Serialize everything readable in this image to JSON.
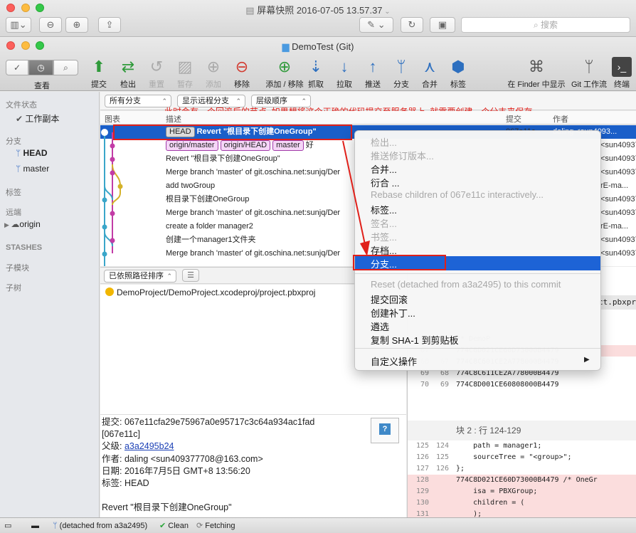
{
  "outer_window": {
    "title": "屏幕快照 2016-07-05 13.57.37",
    "search_placeholder": "搜索"
  },
  "app_window": {
    "title": "DemoTest (Git)",
    "view_label": "查看",
    "toolbar": [
      {
        "label": "提交",
        "icon": "commit-icon",
        "enabled": true
      },
      {
        "label": "检出",
        "icon": "checkout-icon",
        "enabled": true
      },
      {
        "label": "重置",
        "icon": "reset-icon",
        "enabled": false
      },
      {
        "label": "暂存",
        "icon": "stage-icon",
        "enabled": false
      },
      {
        "label": "添加",
        "icon": "add-icon",
        "enabled": false
      },
      {
        "label": "移除",
        "icon": "remove-icon",
        "enabled": true
      },
      {
        "label": "添加 / 移除",
        "icon": "add-remove-icon",
        "enabled": true
      },
      {
        "label": "抓取",
        "icon": "fetch-icon",
        "enabled": true
      },
      {
        "label": "拉取",
        "icon": "pull-icon",
        "enabled": true
      },
      {
        "label": "推送",
        "icon": "push-icon",
        "enabled": true
      },
      {
        "label": "分支",
        "icon": "branch-icon",
        "enabled": true
      },
      {
        "label": "合并",
        "icon": "merge-icon",
        "enabled": true
      },
      {
        "label": "标签",
        "icon": "tag-icon",
        "enabled": true
      }
    ],
    "toolbar_right": [
      {
        "label": "在 Finder 中显示",
        "icon": "finder-icon"
      },
      {
        "label": "Git 工作流",
        "icon": "git-flow-icon"
      },
      {
        "label": "终端",
        "icon": "terminal-icon"
      }
    ]
  },
  "sidebar": {
    "file_status_header": "文件状态",
    "working_copy": "工作副本",
    "branches_header": "分支",
    "branches": [
      "HEAD",
      "master"
    ],
    "tags_header": "标签",
    "remotes_header": "远端",
    "remotes": [
      "origin"
    ],
    "stashes_header": "STASHES",
    "submodules_header": "子模块",
    "subtrees_header": "子树"
  },
  "filters": {
    "branches": "所有分支",
    "remote_branches": "显示远程分支",
    "order": "层级顺序"
  },
  "columns": {
    "graph": "图表",
    "description": "描述",
    "commit": "提交",
    "author": "作者"
  },
  "annotation": "此时会有一个回滚后的节点, 如果想将这个正确的代码提交至服务器上, 就需要创建一个分支来保存",
  "commits": [
    {
      "tags": [
        "HEAD"
      ],
      "desc": "Revert \"根目录下创建OneGroup\"",
      "commit": "067e11c",
      "author": "daling <sun4093..."
    },
    {
      "tags": [
        "origin/master",
        "origin/HEAD",
        "master"
      ],
      "desc": "好",
      "commit": "",
      "author": "<sun40937..."
    },
    {
      "tags": [],
      "desc": "Revert \"根目录下创建OneGroup\"",
      "commit": "",
      "author": "<sun40937..."
    },
    {
      "tags": [],
      "desc": "Merge branch 'master' of git.oschina.net:sunjq/Der",
      "commit": "",
      "author": "<sun40937..."
    },
    {
      "tags": [],
      "desc": "add twoGroup",
      "commit": "",
      "author": "rE-ma..."
    },
    {
      "tags": [],
      "desc": "根目录下创建OneGroup",
      "commit": "",
      "author": "<sun40937..."
    },
    {
      "tags": [],
      "desc": "Merge branch 'master' of git.oschina.net:sunjq/Der",
      "commit": "",
      "author": "<sun40937..."
    },
    {
      "tags": [],
      "desc": "create a folder manager2",
      "commit": "",
      "author": "rE-ma..."
    },
    {
      "tags": [],
      "desc": "创建一个manager1文件夹",
      "commit": "",
      "author": "<sun40937..."
    },
    {
      "tags": [],
      "desc": "Merge branch 'master' of git.oschina.net:sunjq/Der",
      "commit": "",
      "author": "<sun40937..."
    }
  ],
  "file_list": {
    "sort": "已依照路径排序",
    "files": [
      "DemoProject/DemoProject.xcodeproj/project.pbxproj"
    ]
  },
  "details": {
    "commit_label": "提交:",
    "commit_value": "067e11cfa29e75967a0e95717c3c64a934ac1fad",
    "commit_short": "[067e11c]",
    "parent_label": "父级:",
    "parent_value": "a3a2495b24",
    "author_label": "作者:",
    "author_value": "daling <sun409377708@163.com>",
    "date_label": "日期:",
    "date_value": "2016年7月5日 GMT+8 13:56:20",
    "tags_label": "标签:",
    "tags_value": "HEAD",
    "message": "Revert \"根目录下创建OneGroup\""
  },
  "diff": {
    "file_header": "ct.pbxpro",
    "hunk_header": "块 2 : 行 124-129",
    "top_lines": [
      {
        "n1": "",
        "n2": "",
        "text": "/* DemoP",
        "type": "ctx"
      },
      {
        "n1": "67",
        "n2": "",
        "text": "774C8D021CE60D73000B4479",
        "type": "del"
      },
      {
        "n1": "68",
        "n2": "67",
        "text": "774C8C601CE2A778000B4479",
        "type": "ctx"
      },
      {
        "n1": "69",
        "n2": "68",
        "text": "774C8C611CE2A778000B4479",
        "type": "ctx"
      },
      {
        "n1": "70",
        "n2": "69",
        "text": "774C8D001CE60808000B4479",
        "type": "ctx"
      }
    ],
    "hunk_lines": [
      {
        "n1": "125",
        "n2": "124",
        "text": "    path = manager1;",
        "type": "ctx"
      },
      {
        "n1": "126",
        "n2": "125",
        "text": "    sourceTree = \"<group>\";",
        "type": "ctx"
      },
      {
        "n1": "127",
        "n2": "126",
        "text": "};",
        "type": "ctx"
      },
      {
        "n1": "128",
        "n2": "",
        "text": "774C8D021CE60D73000B4479 /* OneGr",
        "type": "del"
      },
      {
        "n1": "129",
        "n2": "",
        "text": "    isa = PBXGroup;",
        "type": "del"
      },
      {
        "n1": "130",
        "n2": "",
        "text": "    children = (",
        "type": "del"
      },
      {
        "n1": "131",
        "n2": "",
        "text": "    );",
        "type": "del"
      }
    ]
  },
  "context_menu": {
    "items": [
      {
        "label": "检出...",
        "enabled": false
      },
      {
        "label": "推送修订版本...",
        "enabled": false
      },
      {
        "label": "合并...",
        "enabled": true
      },
      {
        "label": "衍合 ...",
        "enabled": true
      },
      {
        "label": "Rebase children of 067e11c interactively...",
        "enabled": false
      },
      {
        "label": "标签...",
        "enabled": true
      },
      {
        "label": "签名...",
        "enabled": false
      },
      {
        "label": "书签...",
        "enabled": false
      },
      {
        "label": "存档...",
        "enabled": true
      },
      {
        "label": "分支...",
        "enabled": true,
        "highlighted": true
      },
      {
        "label": "Reset (detached from a3a2495) to this commit",
        "enabled": false
      },
      {
        "label": "提交回滚",
        "enabled": true
      },
      {
        "label": "创建补丁...",
        "enabled": true
      },
      {
        "label": "遴选",
        "enabled": true
      },
      {
        "label": "复制 SHA-1 到剪贴板",
        "enabled": true
      },
      {
        "label": "自定义操作",
        "enabled": true
      }
    ]
  },
  "status_bar": {
    "branch": "(detached from a3a2495)",
    "clean": "Clean",
    "fetching": "Fetching"
  },
  "colors": {
    "selection": "#1a5fc9",
    "menu_highlight": "#1d63d6",
    "annotation_red": "#e0201a",
    "tag_pink": "#f5d6f7"
  }
}
